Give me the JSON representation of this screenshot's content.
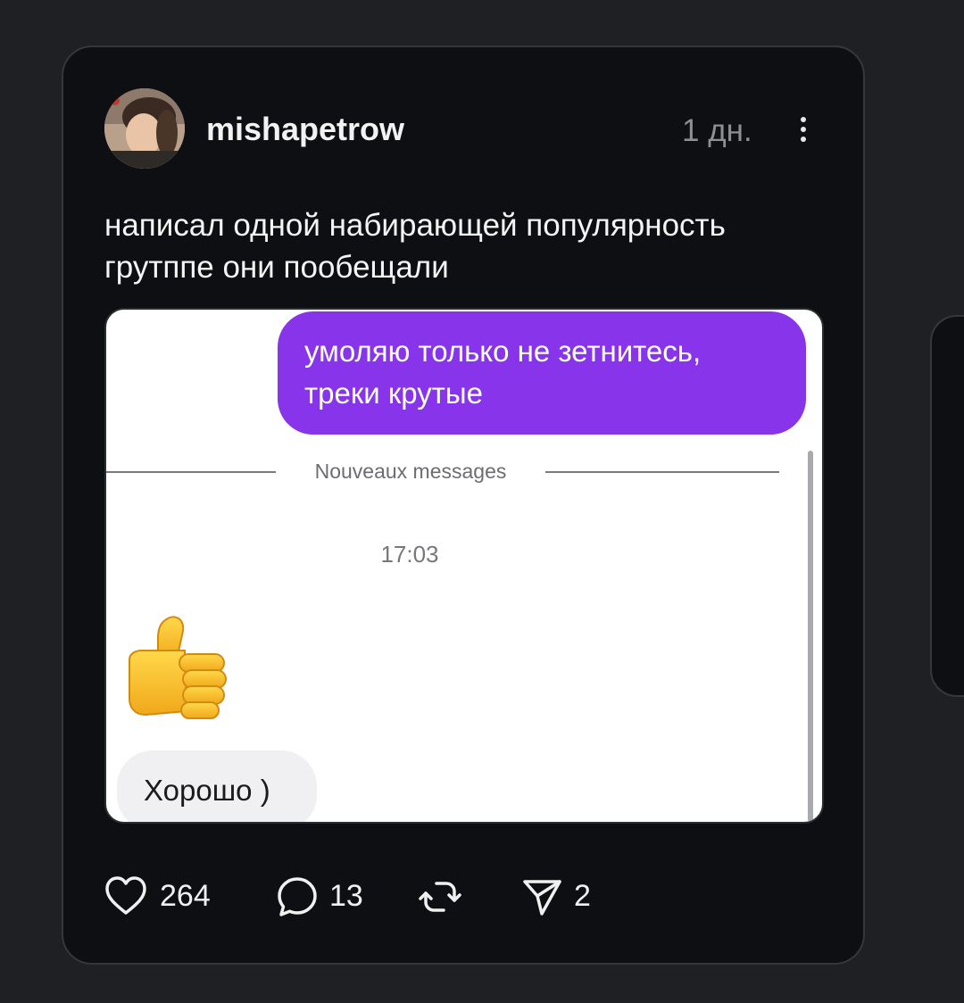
{
  "post": {
    "username": "mishapetrow",
    "time_ago": "1 дн.",
    "caption": "написал одной набирающей популярность грутппе они пообещали"
  },
  "screenshot": {
    "outgoing_message": "умоляю только не зетнитесь, треки крутые",
    "divider_label": "Nouveaux messages",
    "message_time": "17:03",
    "reaction_emoji": "thumbs-up",
    "incoming_message": "Хорошо )"
  },
  "actions": {
    "likes": "264",
    "comments": "13",
    "reposts": "",
    "shares": "2"
  },
  "colors": {
    "background": "#1f2024",
    "card": "#0e0f12",
    "outgoing_bubble": "#8734ea",
    "incoming_bubble": "#f0f0f3"
  },
  "icons": [
    "more-vertical-icon",
    "heart-icon",
    "comment-icon",
    "repost-icon",
    "share-icon"
  ]
}
